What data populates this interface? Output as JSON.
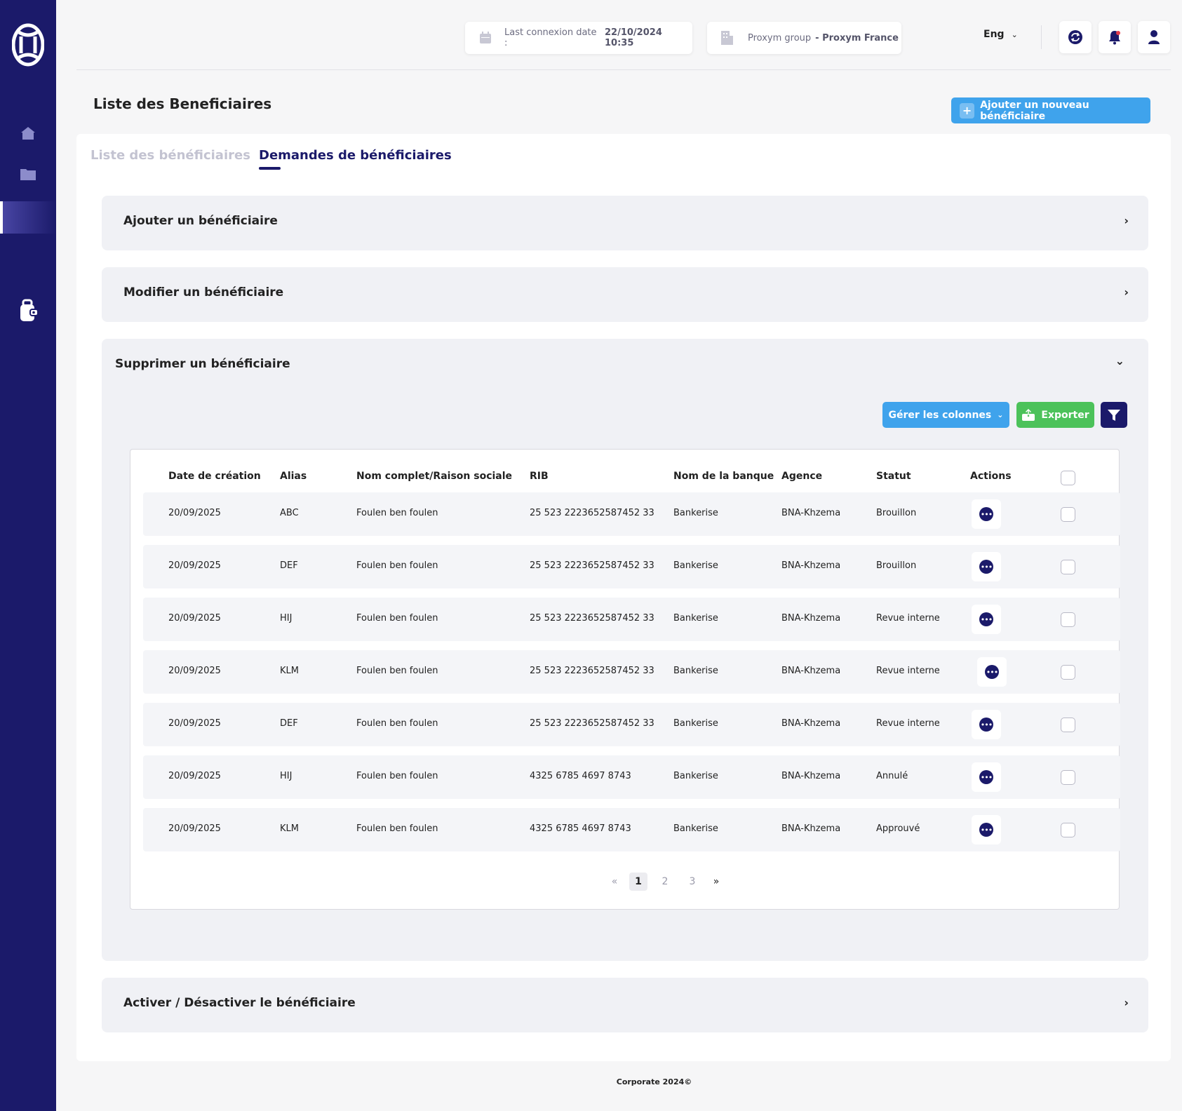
{
  "colors": {
    "sidebar": "#1b1a6a",
    "accent_blue": "#3fa3ec",
    "export_green": "#4cc25a",
    "primary_dark": "#1b1a6a"
  },
  "sidebar": {
    "icons": [
      "logo-icon",
      "home-icon",
      "folder-icon",
      "wallet-icon"
    ]
  },
  "header": {
    "last_connexion_label": "Last connexion date :",
    "last_connexion_value": "22/10/2024 10:35",
    "group_label": "Proxym group",
    "group_value": "- Proxym France",
    "language": "Eng"
  },
  "page": {
    "title": "Liste des Beneficiaires",
    "add_button": "Ajouter un nouveau bénéficiaire"
  },
  "tabs": [
    {
      "label": "Liste des bénéficiaires"
    },
    {
      "label": "Demandes de bénéficiaires"
    }
  ],
  "accordions": {
    "add": "Ajouter un bénéficiaire",
    "edit": "Modifier un bénéficiaire",
    "delete": "Supprimer un bénéficiaire",
    "toggle": "Activer / Désactiver le bénéficiaire"
  },
  "toolbar": {
    "columns": "Gérer les colonnes",
    "export": "Exporter"
  },
  "table": {
    "headers": [
      "Date de création",
      "Alias",
      "Nom complet/Raison sociale",
      "RIB",
      "Nom de la banque",
      "Agence",
      "Statut",
      "Actions"
    ],
    "rows": [
      [
        "20/09/2025",
        "ABC",
        "Foulen ben foulen",
        "25 523 2223652587452 33",
        "Bankerise",
        "BNA-Khzema",
        "Brouillon"
      ],
      [
        "20/09/2025",
        "DEF",
        "Foulen ben foulen",
        "25 523 2223652587452 33",
        "Bankerise",
        "BNA-Khzema",
        "Brouillon"
      ],
      [
        "20/09/2025",
        "HIJ",
        "Foulen ben foulen",
        "25 523 2223652587452 33",
        "Bankerise",
        "BNA-Khzema",
        "Revue interne"
      ],
      [
        "20/09/2025",
        "KLM",
        "Foulen ben foulen",
        "25 523 2223652587452 33",
        "Bankerise",
        "BNA-Khzema",
        "Revue interne"
      ],
      [
        "20/09/2025",
        "DEF",
        "Foulen ben foulen",
        "25 523 2223652587452 33",
        "Bankerise",
        "BNA-Khzema",
        "Revue interne"
      ],
      [
        "20/09/2025",
        "HIJ",
        "Foulen ben foulen",
        "4325  6785  4697  8743",
        "Bankerise",
        "BNA-Khzema",
        "Annulé"
      ],
      [
        "20/09/2025",
        "KLM",
        "Foulen ben foulen",
        "4325  6785  4697  8743",
        "Bankerise",
        "BNA-Khzema",
        "Approuvé"
      ]
    ]
  },
  "pagination": {
    "prev": "«",
    "pages": [
      "1",
      "2",
      "3"
    ],
    "next": "»",
    "current": "1"
  },
  "footer": "Corporate 2024©"
}
